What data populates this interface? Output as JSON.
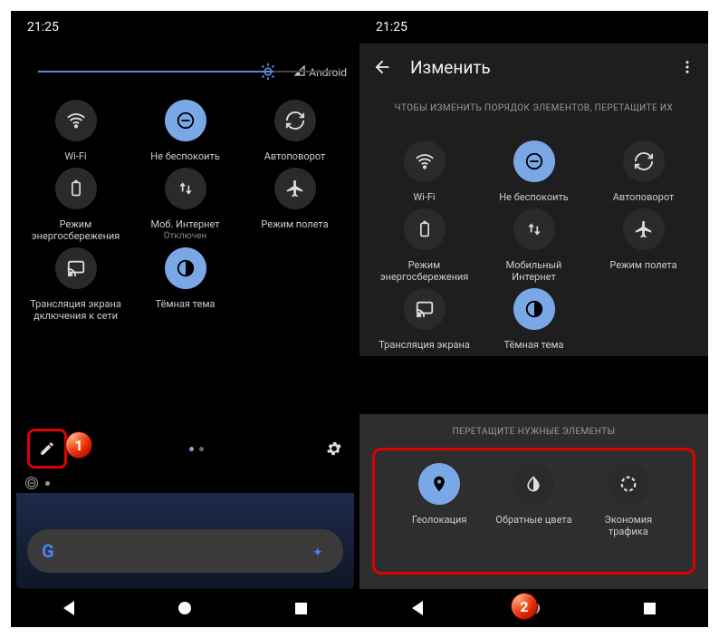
{
  "statusTime": "21:25",
  "networkLabel": "Android",
  "left": {
    "tiles": [
      {
        "icon": "wifi",
        "on": false,
        "label": "Wi-Fi",
        "sub": ""
      },
      {
        "icon": "dnd",
        "on": true,
        "label": "Не беспокоить",
        "sub": ""
      },
      {
        "icon": "rotate",
        "on": false,
        "label": "Автоповорот",
        "sub": ""
      },
      {
        "icon": "battery",
        "on": false,
        "label": "Режим энергосбережения",
        "sub": ""
      },
      {
        "icon": "data",
        "on": false,
        "label": "Моб. Интернет",
        "sub": "Отключен"
      },
      {
        "icon": "airplane",
        "on": false,
        "label": "Режим полета",
        "sub": ""
      },
      {
        "icon": "cast",
        "on": false,
        "label": "Трансляция экрана дключения к сети",
        "sub": ""
      },
      {
        "icon": "dark",
        "on": true,
        "label": "Тёмная тема",
        "sub": ""
      }
    ]
  },
  "right": {
    "title": "Изменить",
    "hint": "ЧТОБЫ ИЗМЕНИТЬ ПОРЯДОК ЭЛЕМЕНТОВ, ПЕРЕТАЩИТЕ ИХ",
    "tiles": [
      {
        "icon": "wifi",
        "on": false,
        "label": "Wi-Fi"
      },
      {
        "icon": "dnd",
        "on": true,
        "label": "Не беспокоить"
      },
      {
        "icon": "rotate",
        "on": false,
        "label": "Автоповорот"
      },
      {
        "icon": "battery",
        "on": false,
        "label": "Режим энергосбережения"
      },
      {
        "icon": "data",
        "on": false,
        "label": "Мобильный Интернет"
      },
      {
        "icon": "airplane",
        "on": false,
        "label": "Режим полета"
      },
      {
        "icon": "cast",
        "on": false,
        "label": "Трансляция экрана"
      },
      {
        "icon": "dark",
        "on": true,
        "label": "Тёмная тема"
      }
    ],
    "dragHint": "ПЕРЕТАЩИТЕ НУЖНЫЕ ЭЛЕМЕНТЫ",
    "available": [
      {
        "icon": "location",
        "on": true,
        "label": "Геолокация"
      },
      {
        "icon": "invert",
        "on": false,
        "label": "Обратные цвета"
      },
      {
        "icon": "datasaver",
        "on": false,
        "label": "Экономия трафика"
      }
    ]
  },
  "badges": {
    "b1": "1",
    "b2": "2"
  }
}
